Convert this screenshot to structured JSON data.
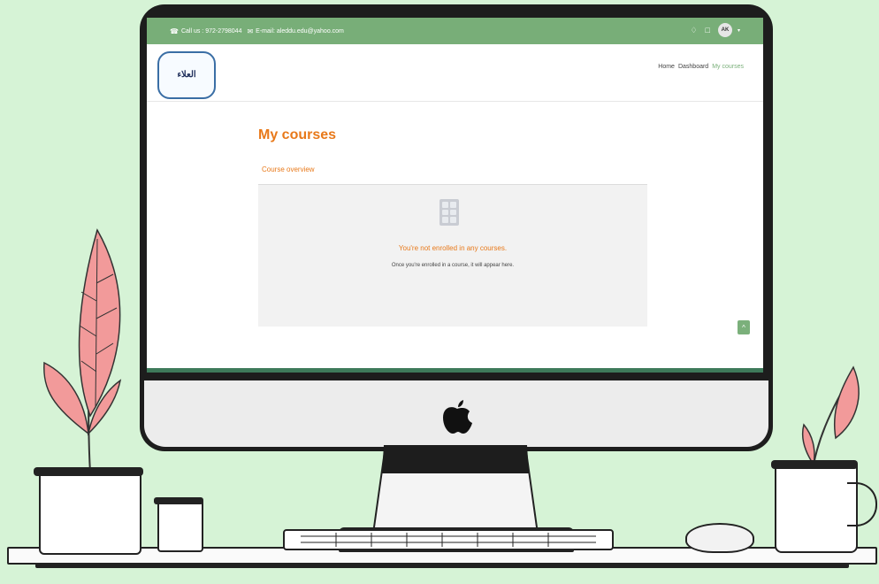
{
  "topbar": {
    "phone_text": "Call us : 972-2798044",
    "email_text": "E-mail: aleddu.edu@yahoo.com",
    "avatar_initials": "AK",
    "bell_icon": "bell-icon",
    "chat_icon": "chat-icon"
  },
  "header": {
    "logo_text": "العلاء",
    "breadcrumb": [
      "Home",
      "Dashboard",
      "My courses"
    ]
  },
  "main": {
    "page_title": "My courses",
    "section_label": "Course overview",
    "empty_title": "You're not enrolled in any courses.",
    "empty_subtitle": "Once you're enrolled in a course, it will appear here."
  },
  "colors": {
    "accent_green": "#78ae78",
    "accent_orange": "#e8791a",
    "background_mint": "#d6f3d6"
  }
}
